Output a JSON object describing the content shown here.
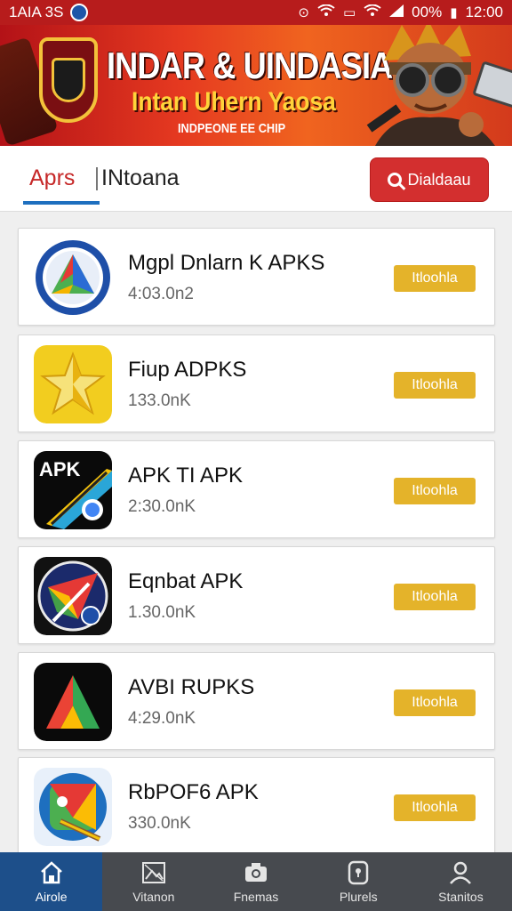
{
  "status_bar": {
    "time_left": "1AIA 3S",
    "battery": "00%",
    "clock": "12:00"
  },
  "banner": {
    "title": "INDAR & UINDASIA",
    "subtitle": "Intan Uhern Yaosa",
    "tagline": "INDPEONE EE CHIP"
  },
  "tabs": {
    "apps": "Aprs",
    "other": "INtoana",
    "button_label": "Dialdaau"
  },
  "apps": [
    {
      "name": "Mgpl Dnlarn K APKS",
      "size": "4:03.0n2",
      "action": "Itloohla"
    },
    {
      "name": "Fiup ADPKS",
      "size": "133.0nK",
      "action": "Itloohla"
    },
    {
      "name": "APK TI APK",
      "size": "2:30.0nK",
      "action": "Itloohla"
    },
    {
      "name": "Eqnbat APK",
      "size": "1.30.0nK",
      "action": "Itloohla"
    },
    {
      "name": "AVBI RUPKS",
      "size": "4:29.0nK",
      "action": "Itloohla"
    },
    {
      "name": "RbPOF6 APK",
      "size": "330.0nK",
      "action": "Itloohla"
    }
  ],
  "bottom_nav": [
    {
      "label": "Airole",
      "icon": "home-icon"
    },
    {
      "label": "Vitanon",
      "icon": "gallery-icon"
    },
    {
      "label": "Fnemas",
      "icon": "camera-icon"
    },
    {
      "label": "Plurels",
      "icon": "phone-icon"
    },
    {
      "label": "Stanitos",
      "icon": "profile-icon"
    }
  ],
  "colors": {
    "status_bar": "#b71c1c",
    "accent_red": "#d32f2f",
    "tab_underline": "#1e6fbf",
    "action_button": "#e4b32a",
    "nav_bg": "#474a4f",
    "nav_active": "#1d4f8a"
  }
}
